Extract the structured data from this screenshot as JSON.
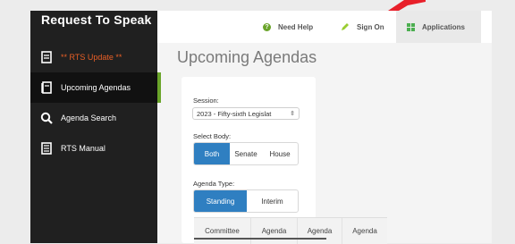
{
  "sidebar": {
    "title": "Request To Speak",
    "items": [
      {
        "label": "** RTS Update **",
        "icon": "document-icon"
      },
      {
        "label": "Upcoming Agendas",
        "icon": "agenda-book-icon"
      },
      {
        "label": "Agenda Search",
        "icon": "search-icon"
      },
      {
        "label": "RTS Manual",
        "icon": "manual-icon"
      }
    ]
  },
  "topbar": {
    "help": "Need Help",
    "sign_on": "Sign On",
    "applications": "Applications"
  },
  "main": {
    "title": "Upcoming Agendas",
    "session_label": "Session:",
    "session_value": "2023 - Fifty-sixth Legislat",
    "body_label": "Select Body:",
    "body_options": [
      "Both",
      "Senate",
      "House"
    ],
    "agenda_type_label": "Agenda Type:",
    "agenda_type_options": [
      "Standing",
      "Interim"
    ],
    "table_headers": [
      "Committee",
      "Agenda",
      "Agenda",
      "Agenda"
    ]
  },
  "colors": {
    "accent_green": "#6aa42a",
    "button_blue": "#2f7fc1",
    "orange_text": "#e85f26",
    "arrow_red": "#e8202a"
  }
}
